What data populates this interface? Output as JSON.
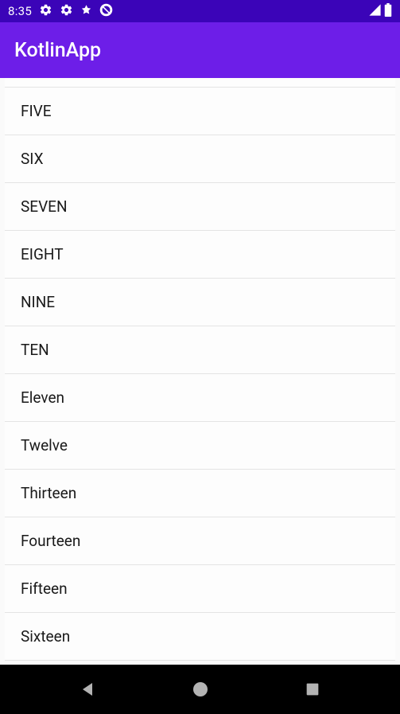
{
  "status_bar": {
    "time": "8:35"
  },
  "app_bar": {
    "title": "KotlinApp"
  },
  "list_items": [
    "FIVE",
    "SIX",
    "SEVEN",
    "EIGHT",
    "NINE",
    "TEN",
    "Eleven",
    "Twelve",
    "Thirteen",
    "Fourteen",
    "Fifteen",
    "Sixteen"
  ]
}
